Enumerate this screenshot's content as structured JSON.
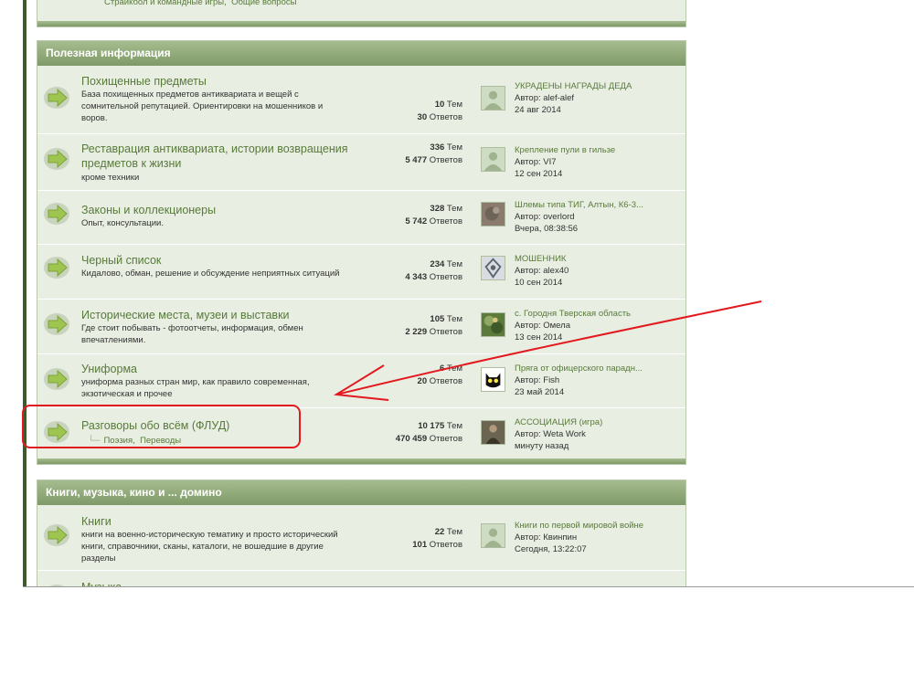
{
  "top_fragment": {
    "sub1": "Страйкбол и командные игры",
    "sub2": "Общие вопросы"
  },
  "sections": [
    {
      "title": "Полезная информация",
      "forums": [
        {
          "title": "Похищенные предметы",
          "desc": "База похищенных предметов антиквариата и вещей с сомнительной репутацией. Ориентировки на мошенников и воров.",
          "topics_num": "10",
          "topics_lbl": "Тем",
          "posts_num": "30",
          "posts_lbl": "Ответов",
          "last_title": "УКРАДЕНЫ НАГРАДЫ ДЕДА",
          "last_author": "Автор: alef-alef",
          "last_date": "24 авг 2014",
          "avatar": "default-avatar"
        },
        {
          "title": "Реставрация антиквариата, истории возвращения предметов к жизни",
          "desc": "кроме техники",
          "topics_num": "336",
          "topics_lbl": "Тем",
          "posts_num": "5 477",
          "posts_lbl": "Ответов",
          "last_title": "Крепление пули в гильзе",
          "last_author": "Автор: VI7",
          "last_date": "12 сен 2014",
          "avatar": "default-avatar"
        },
        {
          "title": "Законы и коллекционеры",
          "desc": "Опыт, консультации.",
          "topics_num": "328",
          "topics_lbl": "Тем",
          "posts_num": "5 742",
          "posts_lbl": "Ответов",
          "last_title": "Шлемы типа ТИГ, Алтын, К6-3...",
          "last_author": "Автор: overlord",
          "last_date": "Вчера, 08:38:56",
          "avatar": "photo-avatar"
        },
        {
          "title": "Черный список",
          "desc": "Кидалово, обман, решение и обсуждение неприятных ситуаций",
          "topics_num": "234",
          "topics_lbl": "Тем",
          "posts_num": "4 343",
          "posts_lbl": "Ответов",
          "last_title": "МОШЕННИК",
          "last_author": "Автор: alex40",
          "last_date": "10 сен 2014",
          "avatar": "emblem-avatar"
        },
        {
          "title": "Исторические места, музеи и выставки",
          "desc": "Где стоит побывать - фотоотчеты, информация, обмен впечатлениями.",
          "topics_num": "105",
          "topics_lbl": "Тем",
          "posts_num": "2 229",
          "posts_lbl": "Ответов",
          "last_title": "с. Городня Тверская область",
          "last_author": "Автор: Омела",
          "last_date": "13 сен 2014",
          "avatar": "nature-avatar"
        },
        {
          "title": "Униформа",
          "desc": "униформа разных стран мир, как правило современная, экзотическая и прочее",
          "topics_num": "6",
          "topics_lbl": "Тем",
          "posts_num": "20",
          "posts_lbl": "Ответов",
          "last_title": "Пряга от офицерского парадн...",
          "last_author": "Автор: Fish",
          "last_date": "23 май 2014",
          "avatar": "cat-avatar"
        },
        {
          "title": "Разговоры обо всём (ФЛУД)",
          "desc": "",
          "subs": [
            "Поэзия",
            "Переводы"
          ],
          "topics_num": "10 175",
          "topics_lbl": "Тем",
          "posts_num": "470 459",
          "posts_lbl": "Ответов",
          "last_title": "АССОЦИАЦИЯ (игра)",
          "last_author": "Автор: Weta Work",
          "last_date": "минуту назад",
          "avatar": "person-avatar"
        }
      ]
    },
    {
      "title": "Книги, музыка, кино и ... домино",
      "forums": [
        {
          "title": "Книги",
          "desc": "книги на военно-историческую тематику и просто исторический книги, справочники, сканы, каталоги, не вошедшие в другие разделы",
          "topics_num": "22",
          "topics_lbl": "Тем",
          "posts_num": "101",
          "posts_lbl": "Ответов",
          "last_title": "Книги по первой мировой войне",
          "last_author": "Автор: Квинпин",
          "last_date": "Сегодня, 13:22:07",
          "avatar": "default-avatar"
        },
        {
          "title": "Музыка",
          "desc": "",
          "topics_num": "",
          "topics_lbl": "",
          "posts_num": "",
          "posts_lbl": "",
          "last_title": "",
          "last_author": "",
          "last_date": "",
          "avatar": ""
        }
      ]
    }
  ],
  "colors": {
    "accent_green": "#587a3a",
    "header_green": "#8aa574",
    "panel_bg": "#e8eee1",
    "annotation_red": "#e3191f"
  },
  "icons": {
    "forum": "forum-arrow-icon"
  }
}
